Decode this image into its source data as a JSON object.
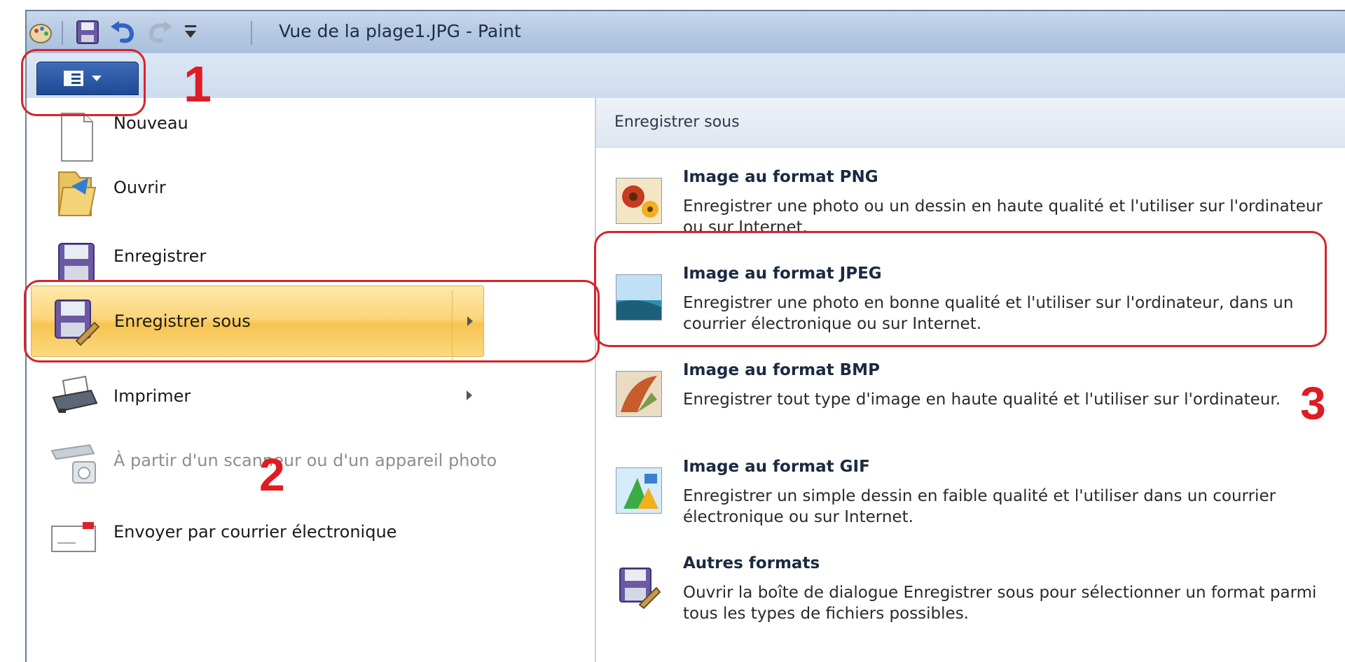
{
  "title_bar": {
    "title": "Vue de la plage1.JPG - Paint",
    "quick_access_icons": [
      "paint-app-icon",
      "save-icon",
      "undo-icon",
      "redo-icon",
      "customize-dropdown-icon"
    ]
  },
  "app_menu": {
    "button_icon": "paint-menu-icon",
    "items": [
      {
        "label": "Nouveau",
        "icon": "new-document-icon",
        "enabled": true
      },
      {
        "label": "Ouvrir",
        "icon": "open-folder-icon",
        "enabled": true
      },
      {
        "label": "Enregistrer",
        "icon": "save-disk-icon",
        "enabled": true
      },
      {
        "label": "Enregistrer sous",
        "icon": "save-as-icon",
        "enabled": true,
        "highlighted": true,
        "has_submenu": true
      },
      {
        "label": "Imprimer",
        "icon": "printer-icon",
        "enabled": true,
        "has_submenu": true
      },
      {
        "label": "À partir d'un scanneur ou d'un appareil photo",
        "icon": "scanner-icon",
        "enabled": false
      },
      {
        "label": "Envoyer par courrier électronique",
        "icon": "email-icon",
        "enabled": true
      }
    ]
  },
  "save_as_panel": {
    "header": "Enregistrer sous",
    "formats": [
      {
        "title": "Image au format PNG",
        "description": "Enregistrer une photo ou un dessin en haute qualité et l'utiliser sur l'ordinateur ou sur Internet.",
        "icon": "png-flowers-icon"
      },
      {
        "title": "Image au format JPEG",
        "description": "Enregistrer une photo en bonne qualité et l'utiliser sur l'ordinateur, dans un courrier électronique ou sur Internet.",
        "icon": "jpeg-landscape-icon"
      },
      {
        "title": "Image au format BMP",
        "description": "Enregistrer tout type d'image en haute qualité et l'utiliser sur l'ordinateur.",
        "icon": "bmp-paint-icon"
      },
      {
        "title": "Image au format GIF",
        "description": "Enregistrer un simple dessin en faible qualité et l'utiliser dans un courrier électronique ou sur Internet.",
        "icon": "gif-shapes-icon"
      },
      {
        "title": "Autres formats",
        "description": "Ouvrir la boîte de dialogue Enregistrer sous pour sélectionner un format parmi tous les types de fichiers possibles.",
        "icon": "other-formats-icon"
      }
    ]
  },
  "annotations": {
    "step1": "1",
    "step2": "2",
    "step3": "3",
    "color": "#d8232a"
  }
}
